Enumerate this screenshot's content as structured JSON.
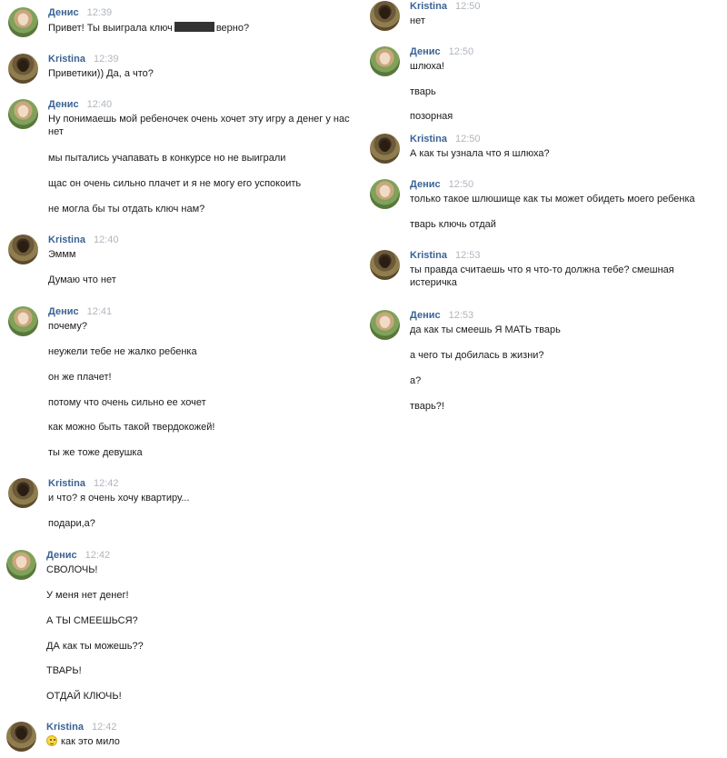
{
  "left_column": [
    {
      "sender": "Денис",
      "avatar": "denis",
      "time": "12:39",
      "lines": [
        "Привет! Ты выиграла ключ",
        "верно?"
      ]
    },
    {
      "sender": "Kristina",
      "avatar": "kristina",
      "time": "12:39",
      "lines": [
        "Приветики)) Да, а что?"
      ]
    },
    {
      "sender": "Денис",
      "avatar": "denis",
      "time": "12:40",
      "lines": [
        "Ну понимаешь мой ребеночек очень хочет эту игру а денег у нас нет",
        "мы пытались учапавать в конкурсе но не выиграли",
        "щас он очень сильно плачет и я не могу его успокоить",
        "не могла бы ты отдать ключ нам?"
      ]
    },
    {
      "sender": "Kristina",
      "avatar": "kristina",
      "time": "12:40",
      "lines": [
        "Эммм",
        "Думаю что нет"
      ]
    },
    {
      "sender": "Денис",
      "avatar": "denis",
      "time": "12:41",
      "lines": [
        "почему?",
        "неужели тебе не жалко ребенка",
        "он же плачет!",
        "потому что очень сильно ее хочет",
        "как можно быть такой твердокожей!",
        "ты же тоже девушка"
      ]
    },
    {
      "sender": "Kristina",
      "avatar": "kristina",
      "time": "12:42",
      "lines": [
        "и что? я очень хочу квартиру...",
        "подари,а?"
      ]
    },
    {
      "sender": "Денис",
      "avatar": "denis",
      "time": "12:42",
      "lines": [
        "СВОЛОЧЬ!",
        "У меня нет денег!",
        "А ТЫ СМЕЕШЬСЯ?",
        "ДА как ты можешь??",
        "ТВАРЬ!",
        "ОТДАЙ КЛЮЧЬ!"
      ]
    },
    {
      "sender": "Kristina",
      "avatar": "kristina",
      "time": "12:42",
      "lines": [
        "как это мило"
      ],
      "emoji": "smile-emoji"
    }
  ],
  "right_column": [
    {
      "sender": "Kristina",
      "avatar": "kristina",
      "time": "12:50",
      "lines": [
        "нет"
      ]
    },
    {
      "sender": "Денис",
      "avatar": "denis",
      "time": "12:50",
      "lines": [
        "шлюха!",
        "тварь",
        "позорная"
      ]
    },
    {
      "sender": "Kristina",
      "avatar": "kristina",
      "time": "12:50",
      "lines": [
        "А как ты узнала что я шлюха?"
      ]
    },
    {
      "sender": "Денис",
      "avatar": "denis",
      "time": "12:50",
      "lines": [
        "только такое шлюшище как ты может обидеть моего ребенка",
        "тварь ключь отдай"
      ]
    },
    {
      "sender": "Kristina",
      "avatar": "kristina",
      "time": "12:53",
      "lines": [
        "ты правда считаешь что я что-то должна тебе? смешная истеричка"
      ]
    },
    {
      "sender": "Денис",
      "avatar": "denis",
      "time": "12:53",
      "lines": [
        "да как ты смеешь Я МАТЬ тварь",
        "а чего ты добилась в жизни?",
        "а?",
        "тварь?!"
      ]
    }
  ]
}
